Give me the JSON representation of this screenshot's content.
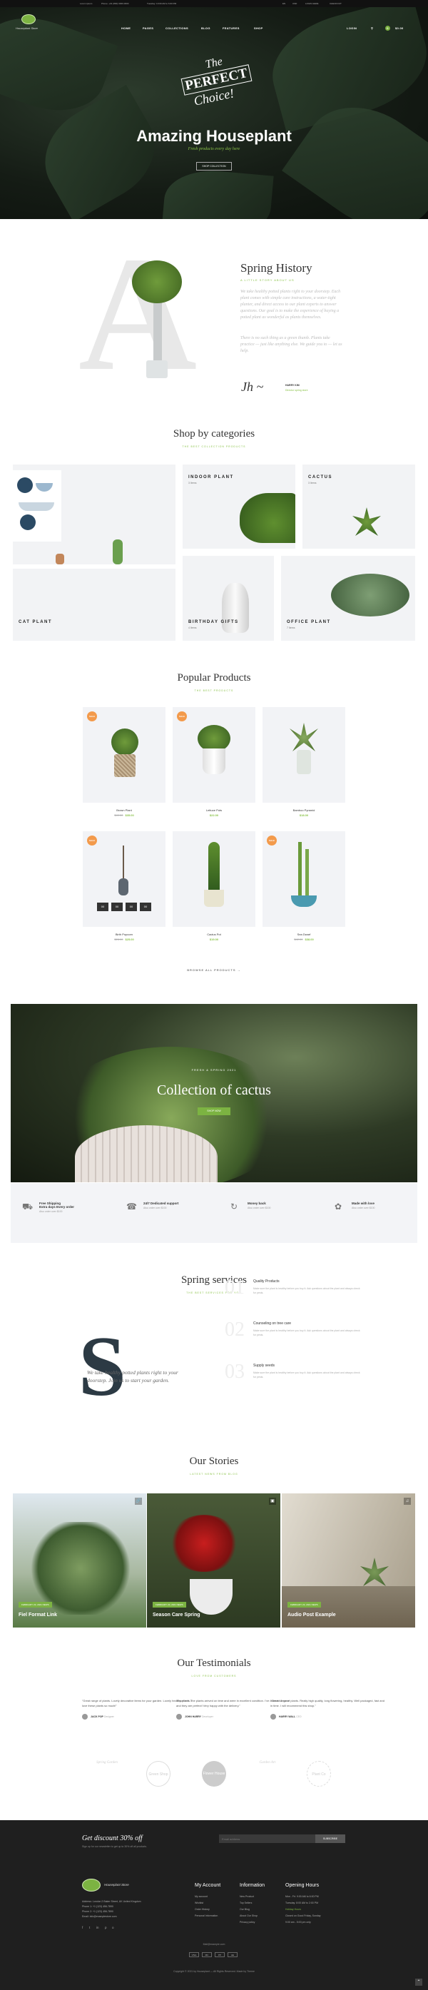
{
  "topbar": {
    "left": [
      "Lorem ipsum",
      "Phone: +01 (800) 0000-0000",
      "Tuesday: 10:00 AM to 6:00 PM"
    ],
    "right": [
      "EN",
      "USD",
      "LOGIN HERE",
      "CHECKOUT"
    ]
  },
  "nav": {
    "logo_text": "Houseplant Store",
    "items": [
      "HOME",
      "PAGES",
      "COLLECTIONS",
      "BLOG",
      "FEATURES",
      "SHOP"
    ],
    "right": [
      "LOGIN",
      "0",
      "$0.00"
    ]
  },
  "hero": {
    "badge_line1": "The",
    "badge_line2": "PERFECT",
    "badge_line3": "Choice!",
    "title": "Amazing Houseplant",
    "subtitle": "Fresh products every day here",
    "button": "SHOP COLLECTION"
  },
  "history": {
    "title": "Spring History",
    "subtitle": "A LITTLE STORY ABOUT US",
    "para1": "We take healthy potted plants right to your doorstep. Each plant comes with simple care instructions, a water-tight planter, and direct access to our plant experts to answer questions. Our goal is to make the experience of buying a potted plant as wonderful as plants themselves.",
    "para2": "There is no such thing as a green thumb. Plants take practice — just like anything else. We guide you to — let us help.",
    "signer_name": "HARRY KIM",
    "signer_role": "Director spring store"
  },
  "categories": {
    "title": "Shop by categories",
    "subtitle": "THE BEST COLLECTION PRODUCTS",
    "items": [
      {
        "name": "CAT PLANT",
        "count": ""
      },
      {
        "name": "INDOOR PLANT",
        "count": "3 Items"
      },
      {
        "name": "CACTUS",
        "count": "3 Items"
      },
      {
        "name": "BIRTHDAY GIFTS",
        "count": "4 Items"
      },
      {
        "name": "OFFICE PLANT",
        "count": "7 Items"
      }
    ]
  },
  "products": {
    "title": "Popular Products",
    "subtitle": "THE BEST PRODUCTS",
    "browse": "BROWSE ALL PRODUCTS",
    "items": [
      {
        "name": "Brown Plant",
        "old": "$40.00",
        "price": "$35.00",
        "sale": "SALE"
      },
      {
        "name": "Lettuce Pots",
        "old": "",
        "price": "$22.00",
        "sale": "SALE"
      },
      {
        "name": "Bamboo Pyramid",
        "old": "",
        "price": "$18.00",
        "sale": ""
      },
      {
        "name": "Birth Popcorn",
        "old": "$28.00",
        "price": "$25.00",
        "sale": "SALE"
      },
      {
        "name": "Cactus Pot",
        "old": "",
        "price": "$19.00",
        "sale": ""
      },
      {
        "name": "Sea Dwarf",
        "old": "$42.00",
        "price": "$38.00",
        "sale": "SALE"
      }
    ],
    "countdown": [
      "00",
      "00",
      "00",
      "00"
    ]
  },
  "cactus_banner": {
    "eyebrow": "FRESH & SPRING 2021",
    "title": "Collection of cactus",
    "button": "SHOP NOW"
  },
  "features": [
    {
      "title": "Free Shipping",
      "title2": "Extra days Every order",
      "sub": "Also order over $100"
    },
    {
      "title": "24/7 Dedicated support",
      "title2": "",
      "sub": "Also order over $100"
    },
    {
      "title": "Money back",
      "title2": "",
      "sub": "Also order over $100"
    },
    {
      "title": "Made with love",
      "title2": "",
      "sub": "Also order over $100"
    }
  ],
  "services": {
    "title": "Spring services",
    "subtitle": "THE BEST SERVICES FOR YOU",
    "quote": "We take healthy potted plants right to your doorstep. Join us to start your garden.",
    "items": [
      {
        "num": "01",
        "title": "Quality Products",
        "desc": "Make sure the plant is healthy before you buy it. Ask questions about the plant and always check for pests."
      },
      {
        "num": "02",
        "title": "Counseling on tree care",
        "desc": "Make sure the plant is healthy before you buy it. Ask questions about the plant and always check for pests."
      },
      {
        "num": "03",
        "title": "Supply seeds",
        "desc": "Make sure the plant is healthy before you buy it. Ask questions about the plant and always check for pests."
      }
    ]
  },
  "stories": {
    "title": "Our Stories",
    "subtitle": "LATEST NEWS FROM BLOG",
    "items": [
      {
        "tag": "FEBRUARY 20, 2021  NEWS",
        "title": "Fiel Format Link"
      },
      {
        "tag": "FEBRUARY 20, 2021  NEWS",
        "title": "Season Care Spring"
      },
      {
        "tag": "FEBRUARY 20, 2021  NEWS",
        "title": "Audio Post Example"
      }
    ]
  },
  "testimonials": {
    "title": "Our Testimonials",
    "subtitle": "LOVE FROM CUSTOMERS",
    "items": [
      {
        "quote": "\"Great range of plants. Lovely decorative items for your garden. Lovely healthy plants. I love these plants so much!\"",
        "name": "JACK POP",
        "role": "Designer"
      },
      {
        "quote": "\"Excellent. The plants arrived on time and were in excellent condition. I've ordered 2 more and they are perfect! Very happy with the delivery.\"",
        "name": "JOHN HARRY",
        "role": "Developer"
      },
      {
        "quote": "\"Great range of plants. Really high quality, long flowering, healthy. Well packaged, fast and in time. I will recommend this shop.\"",
        "name": "HARRY WALL",
        "role": "CEO"
      }
    ],
    "brands": [
      "Spring Garden",
      "Green Shop",
      "Flower House",
      "Garden Art",
      "Plant Co"
    ]
  },
  "footer": {
    "newsletter_title": "Get discount 30% off",
    "newsletter_sub": "Sign up for our newsletter to get up to 30% off all products.",
    "email_placeholder": "Email address",
    "subscribe": "SUBSCRIBE",
    "logo_text": "Houseplant Store",
    "address": [
      "Address: London 2 Baker Street, UK United Kingdom",
      "Phone 1: +1 (123) 456-7890",
      "Phone 2: +1 (123) 456-7890",
      "Email: info@examplestore.com"
    ],
    "social": [
      "f",
      "t",
      "in",
      "p",
      "o"
    ],
    "col1_title": "My Account",
    "col1": [
      "My account",
      "Wishlist",
      "Order History",
      "Personal Information"
    ],
    "col2_title": "Information",
    "col2": [
      "New Product",
      "Top Sellers",
      "Our Blog",
      "About Our Shop",
      "Privacy policy"
    ],
    "col3_title": "Opening Hours",
    "col3": [
      "Mon - Fri: 9:00 AM to 6:00 PM",
      "Tuesday: 8:00 AM to 2:00 PM",
      "Holiday Hours",
      "Closed on Good Friday, Sunday",
      "9:00 am - 5:00 pm only"
    ],
    "payments": [
      "VISA",
      "MC",
      "PP",
      "AE"
    ],
    "email_line": "Mail@example.com",
    "copyright": "Copyright © 2021 by Houseplant — All Rights Reserved. Made by Theme"
  }
}
